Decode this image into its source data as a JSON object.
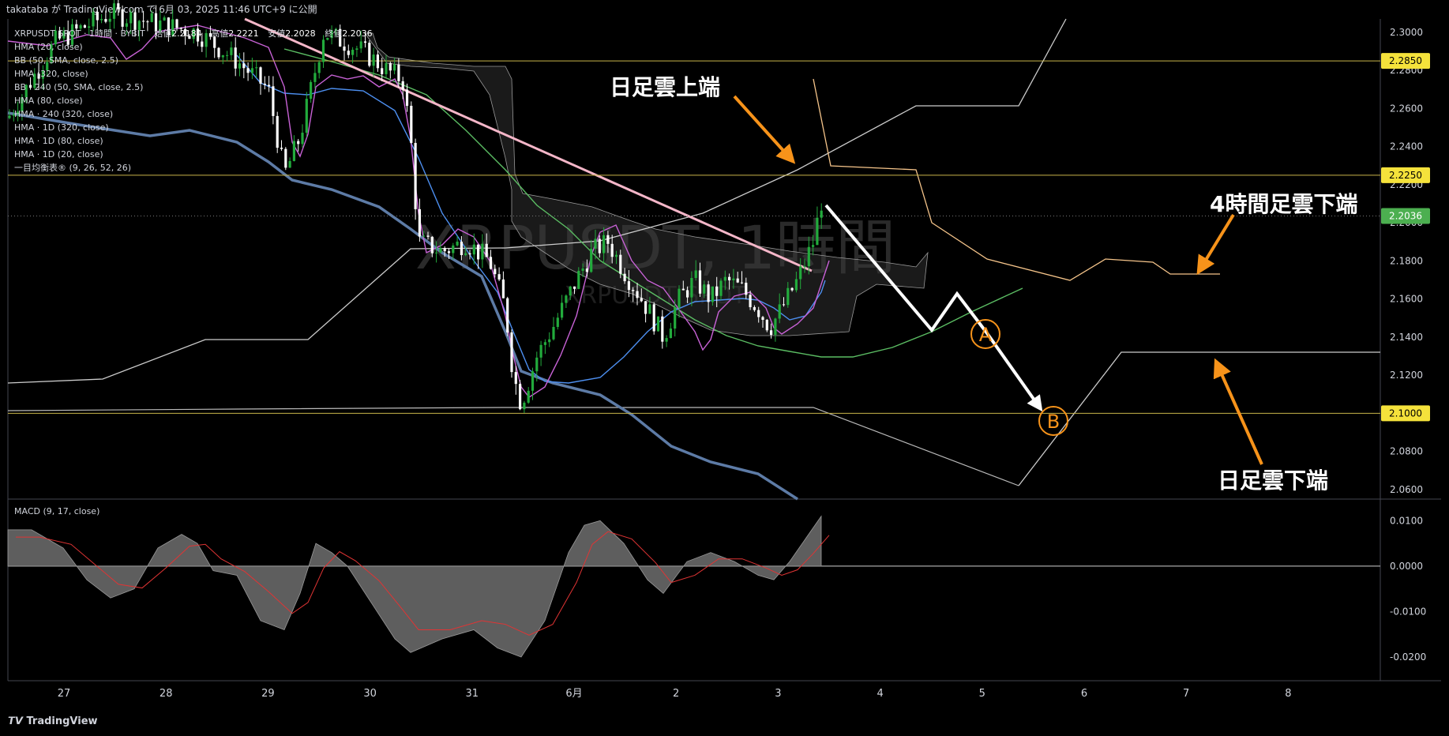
{
  "header": {
    "caption": "takataba が TradingView.com で 6月 03, 2025 11:46 UTC+9 に公開"
  },
  "symbol_line": {
    "symbol": "XRPUSDT SPOT · 1時間 · BYBIT",
    "open_label": "始値",
    "open": "2.2184",
    "high_label": "高値",
    "high": "2.2221",
    "low_label": "安値",
    "low": "2.2028",
    "close_label": "終値",
    "close": "2.2036"
  },
  "indicators": [
    "HMA (20, close)",
    "BB (50, SMA, close, 2.5)",
    "HMA (320, close)",
    "BB · 240 (50, SMA, close, 2.5)",
    "HMA (80, close)",
    "HMA · 240 (320, close)",
    "HMA · 1D (320, close)",
    "HMA · 1D (80, close)",
    "HMA · 1D (20, close)",
    "一目均衡表® (9, 26, 52, 26)"
  ],
  "watermark": {
    "main": "XRPUSDT, 1時間",
    "sub": "XRPUSDT SPOT"
  },
  "annotations": {
    "daily_cloud_top": "日足雲上端",
    "h4_cloud_bottom": "4時間足雲下端",
    "daily_cloud_bottom": "日足雲下端",
    "point_a": "A",
    "point_b": "B"
  },
  "macd_label": "MACD (9, 17, close)",
  "footer": {
    "brand": "TradingView"
  },
  "colors": {
    "background": "#000000",
    "bull": "#22ab3c",
    "bear": "#ffffff",
    "level_line": "#c8b44a",
    "level_tag_bg": "#f5e23b",
    "last_price_bg": "#4caf50",
    "trendline": "#f4b6c8",
    "annotation_arrow": "#f7931a",
    "hma_purple": "#c862d6",
    "hma_blue": "#4d8ff0",
    "hma_green": "#5bbd63",
    "hma_slate": "#5d7ba6",
    "bb_white": "#cccccc",
    "bb_peach": "#f5c48a"
  },
  "chart_data": {
    "type": "candlestick",
    "x_unit": "date",
    "xticks": [
      "27",
      "28",
      "29",
      "30",
      "31",
      "6月",
      "2",
      "3",
      "4",
      "5",
      "6",
      "7",
      "8"
    ],
    "ylim": [
      2.055,
      2.307
    ],
    "yticks": [
      "2.3000",
      "2.2800",
      "2.2600",
      "2.2400",
      "2.2200",
      "2.2000",
      "2.1800",
      "2.1600",
      "2.1400",
      "2.1200",
      "2.1000",
      "2.0800",
      "2.0600"
    ],
    "price_levels": [
      {
        "label": "2.2850",
        "value": 2.285
      },
      {
        "label": "2.2250",
        "value": 2.225
      },
      {
        "label": "2.1000",
        "value": 2.1
      }
    ],
    "last_price": {
      "label": "2.2036",
      "value": 2.2036
    },
    "macd": {
      "ylim": [
        -0.024,
        0.0125
      ],
      "yticks": [
        "0.0100",
        "0.0000",
        "-0.0100",
        "-0.0200"
      ]
    }
  }
}
